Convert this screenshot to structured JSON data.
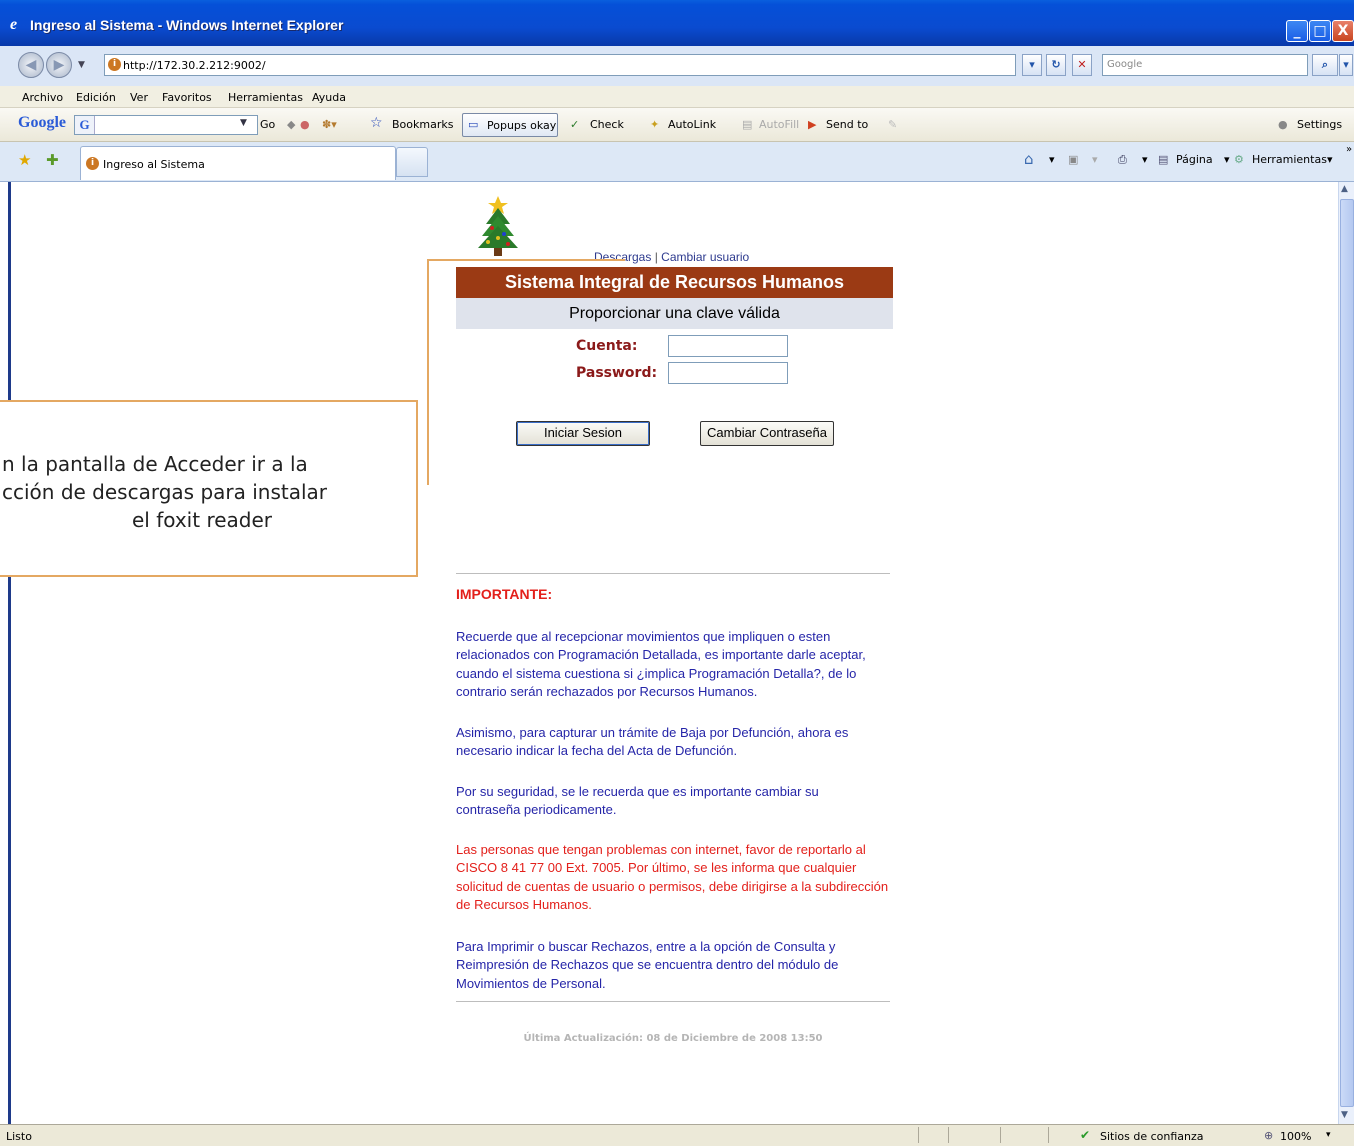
{
  "window": {
    "title": "Ingreso al Sistema - Windows Internet Explorer",
    "min_label": "_",
    "max_label": "□",
    "close_label": "X"
  },
  "address": {
    "url": "http://172.30.2.212:9002/",
    "search_placeholder": "Google"
  },
  "menu": [
    "Archivo",
    "Edición",
    "Ver",
    "Favoritos",
    "Herramientas",
    "Ayuda"
  ],
  "google_toolbar": {
    "logo": "Google",
    "go": "Go",
    "bookmarks": "Bookmarks",
    "popups": "Popups okay",
    "check": "Check",
    "autolink": "AutoLink",
    "autofill": "AutoFill",
    "sendto": "Send to",
    "settings": "Settings"
  },
  "tab": {
    "label": "Ingreso al Sistema"
  },
  "commandbar": {
    "pagina": "Página",
    "herramientas": "Herramientas"
  },
  "login": {
    "link_downloads": "Descargas",
    "link_separator": "|",
    "link_change_user": "Cambiar usuario",
    "title": "Sistema Integral de Recursos Humanos",
    "subtitle": "Proporcionar una clave válida",
    "account_label": "Cuenta:",
    "password_label": "Password:",
    "account_value": "",
    "password_value": "",
    "login_button": "Iniciar Sesion",
    "change_password_button": "Cambiar Contraseña"
  },
  "callout": {
    "text": "n la pantalla de Acceder ir a la\ncción de descargas para instalar\nel foxit reader"
  },
  "notices": {
    "heading": "IMPORTANTE:",
    "p1": "Recuerde que al recepcionar movimientos que impliquen o esten relacionados con Programación Detallada, es importante darle aceptar, cuando el sistema cuestiona si ¿implica Programación Detalla?, de lo contrario serán rechazados por Recursos Humanos.",
    "p2": "Asimismo, para capturar un trámite de Baja por Defunción, ahora es necesario indicar la fecha del Acta de Defunción.",
    "p3": "Por su seguridad, se le recuerda que es importante cambiar su contraseña periodicamente.",
    "p4": "Las personas que tengan problemas con internet, favor de reportarlo al CISCO 8 41 77 00 Ext. 7005. Por último, se les informa que cualquier solicitud de cuentas de usuario o permisos, debe dirigirse a la subdirección de Recursos Humanos.",
    "p5": "Para Imprimir o buscar Rechazos, entre a la opción de Consulta y Reimpresión de Rechazos que se encuentra dentro del módulo de Movimientos de Personal.",
    "updated": "Última Actualización: 08 de Diciembre de 2008 13:50"
  },
  "status": {
    "text": "Listo",
    "zone": "Sitios de confianza",
    "zoom": "100%"
  }
}
